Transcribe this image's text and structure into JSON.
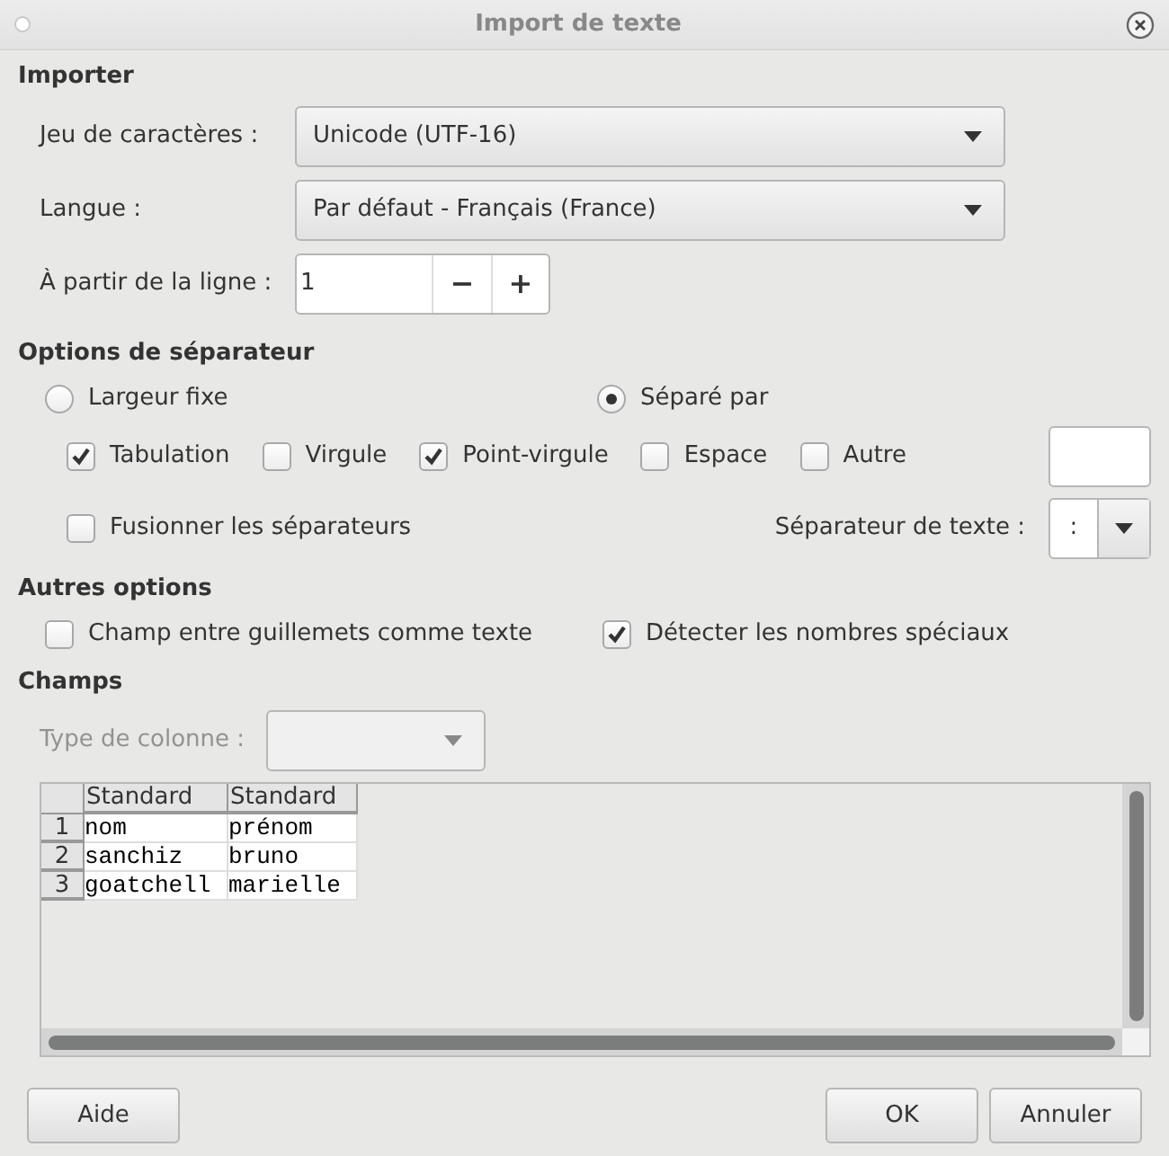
{
  "window": {
    "title": "Import de texte"
  },
  "importer": {
    "heading": "Importer",
    "charset": {
      "label": "Jeu de caractères :",
      "value": "Unicode (UTF-16)"
    },
    "language": {
      "label": "Langue :",
      "value": "Par défaut - Français (France)"
    },
    "from_line": {
      "label": "À partir de la ligne :",
      "value": "1",
      "minus": "−",
      "plus": "+"
    }
  },
  "separator_options": {
    "heading": "Options de séparateur",
    "modes": [
      {
        "label": "Largeur fixe",
        "selected": false
      },
      {
        "label": "Séparé par",
        "selected": true
      }
    ],
    "separators": [
      {
        "label": "Tabulation",
        "checked": true
      },
      {
        "label": "Virgule",
        "checked": false
      },
      {
        "label": "Point-virgule",
        "checked": true
      },
      {
        "label": "Espace",
        "checked": false
      },
      {
        "label": "Autre",
        "checked": false
      }
    ],
    "merge": {
      "label": "Fusionner les séparateurs",
      "checked": false
    },
    "text_separator": {
      "label": "Séparateur de texte :",
      "value": ":"
    }
  },
  "other_options": {
    "heading": "Autres options",
    "options": [
      {
        "label": "Champ entre guillemets comme texte",
        "checked": false
      },
      {
        "label": "Détecter les nombres spéciaux",
        "checked": true
      }
    ]
  },
  "fields": {
    "heading": "Champs",
    "column_type": {
      "label": "Type de colonne :",
      "disabled": true
    },
    "table": {
      "columns": [
        "Standard",
        "Standard"
      ],
      "rows": [
        {
          "number": "1",
          "cells": [
            "nom",
            "prénom"
          ]
        },
        {
          "number": "2",
          "cells": [
            "sanchiz",
            "bruno"
          ]
        },
        {
          "number": "3",
          "cells": [
            "goatchell",
            "marielle"
          ]
        }
      ]
    }
  },
  "buttons": {
    "help": "Aide",
    "ok": "OK",
    "cancel": "Annuler"
  }
}
